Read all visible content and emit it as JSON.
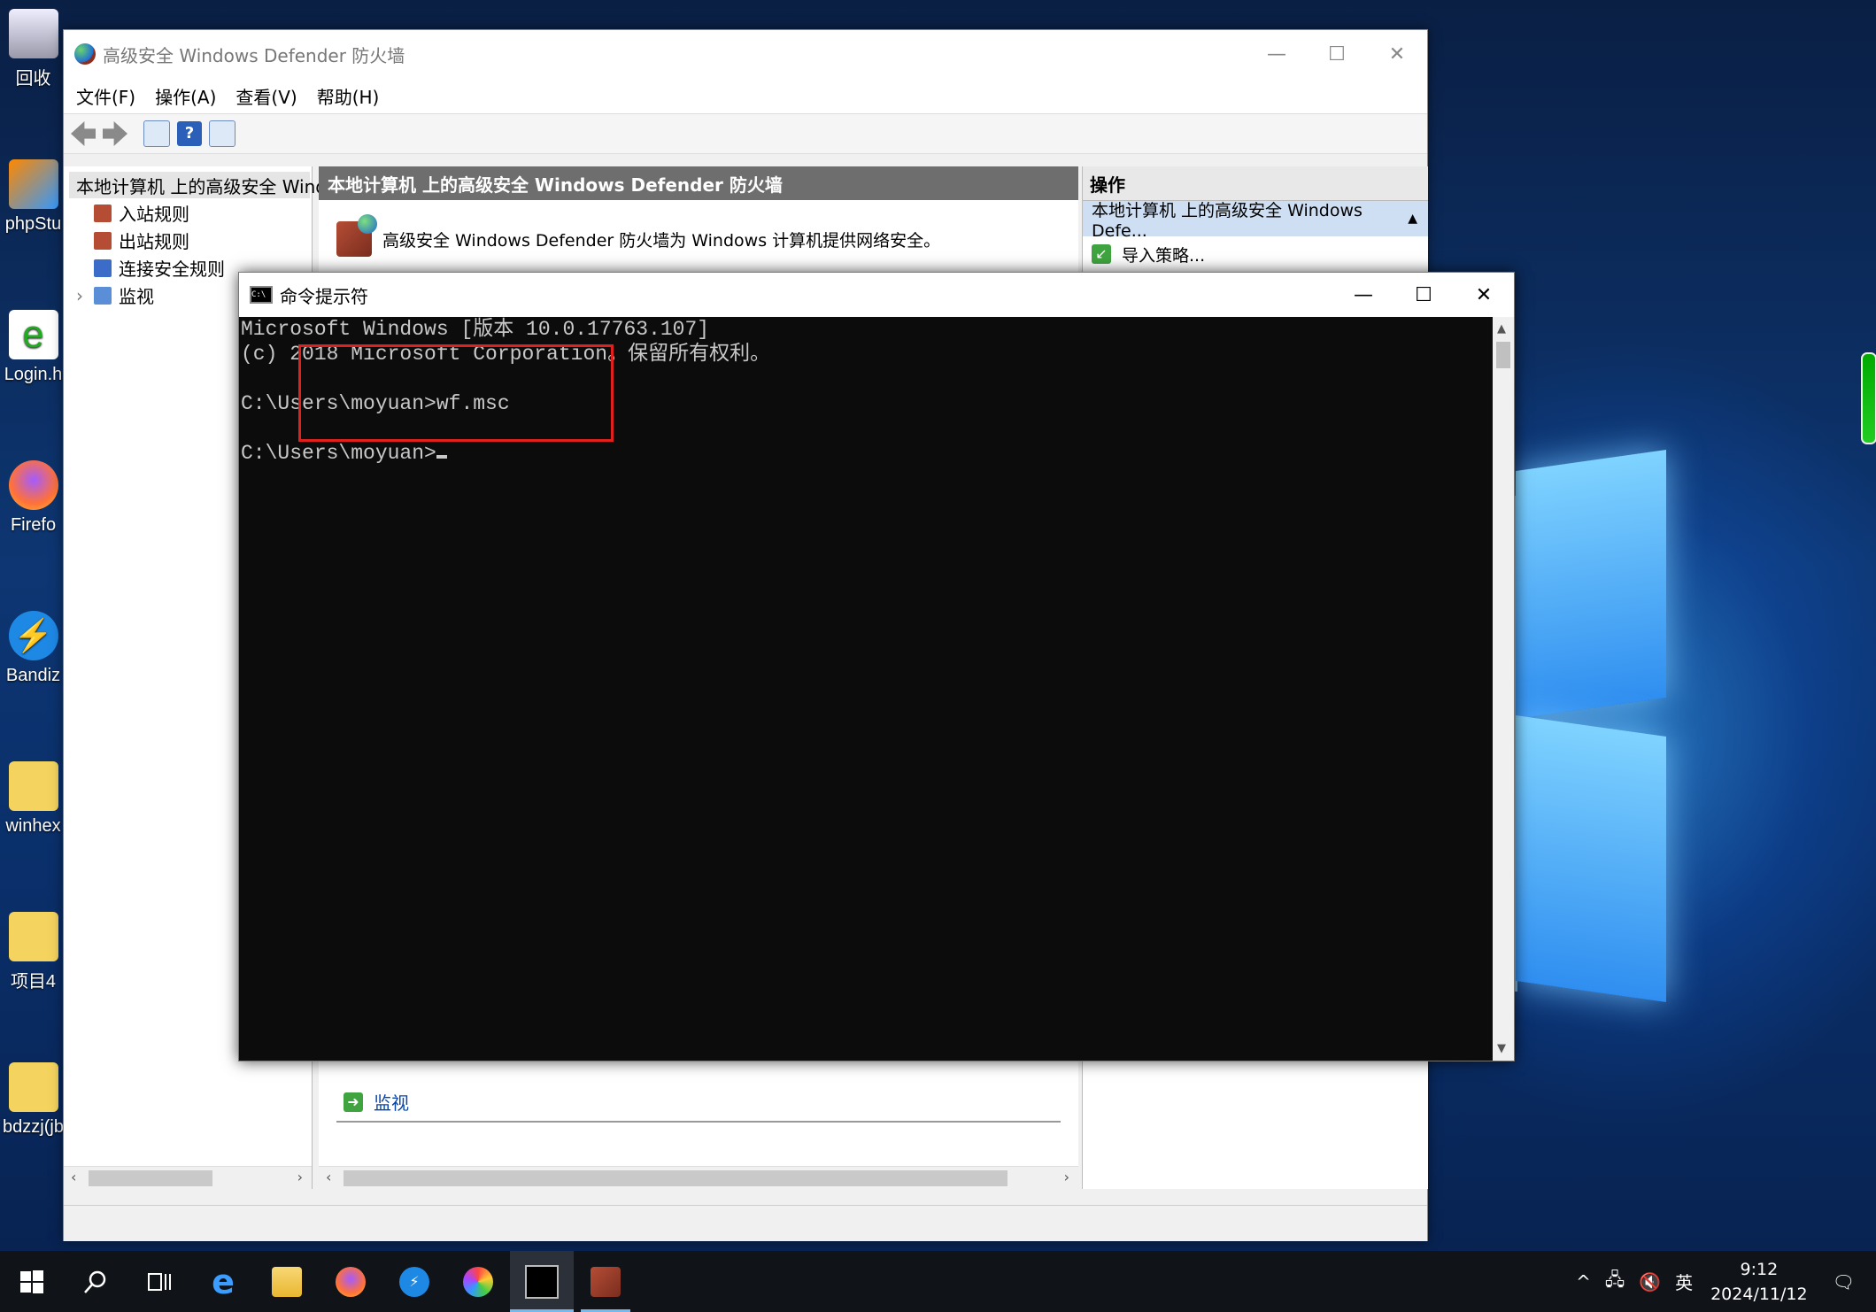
{
  "desktop": {
    "icons": [
      {
        "label": "回收"
      },
      {
        "label": "phpStu"
      },
      {
        "label": "Login.h"
      },
      {
        "label": "Firefo"
      },
      {
        "label": "Bandiz"
      },
      {
        "label": "winhex"
      },
      {
        "label": "项目4"
      },
      {
        "label": "bdzzj(jb"
      }
    ]
  },
  "firewall": {
    "title": "高级安全 Windows Defender 防火墙",
    "caption": {
      "minimize": "—",
      "maximize": "☐",
      "close": "✕"
    },
    "menu": [
      "文件(F)",
      "操作(A)",
      "查看(V)",
      "帮助(H)"
    ],
    "tree": {
      "root": "本地计算机 上的高级安全 Windc",
      "items": [
        "入站规则",
        "出站规则",
        "连接安全规则",
        "监视"
      ],
      "expander": "›"
    },
    "center": {
      "header": "本地计算机 上的高级安全 Windows Defender 防火墙",
      "description": "高级安全 Windows Defender 防火墙为 Windows 计算机提供网络安全。",
      "monitor_link": "监视"
    },
    "actions": {
      "header": "操作",
      "section": "本地计算机 上的高级安全 Windows Defe...",
      "items": [
        "导入策略..."
      ]
    },
    "scroll_arrows": {
      "left": "‹",
      "right": "›"
    }
  },
  "cmd": {
    "title": "命令提示符",
    "icon_text": "C:\\",
    "caption": {
      "minimize": "—",
      "maximize": "☐",
      "close": "✕"
    },
    "lines": [
      "Microsoft Windows [版本 10.0.17763.107]",
      "(c) 2018 Microsoft Corporation。保留所有权利。",
      "",
      "C:\\Users\\moyuan>wf.msc",
      "",
      "C:\\Users\\moyuan>"
    ],
    "scroll_arrows": {
      "up": "▲",
      "down": "▼"
    }
  },
  "taskbar": {
    "tray": {
      "chevron": "^",
      "ime": "英",
      "time": "9:12",
      "date": "2024/11/12"
    }
  },
  "colors": {
    "highlight": "#e0201c",
    "accent": "#76b9ed"
  }
}
